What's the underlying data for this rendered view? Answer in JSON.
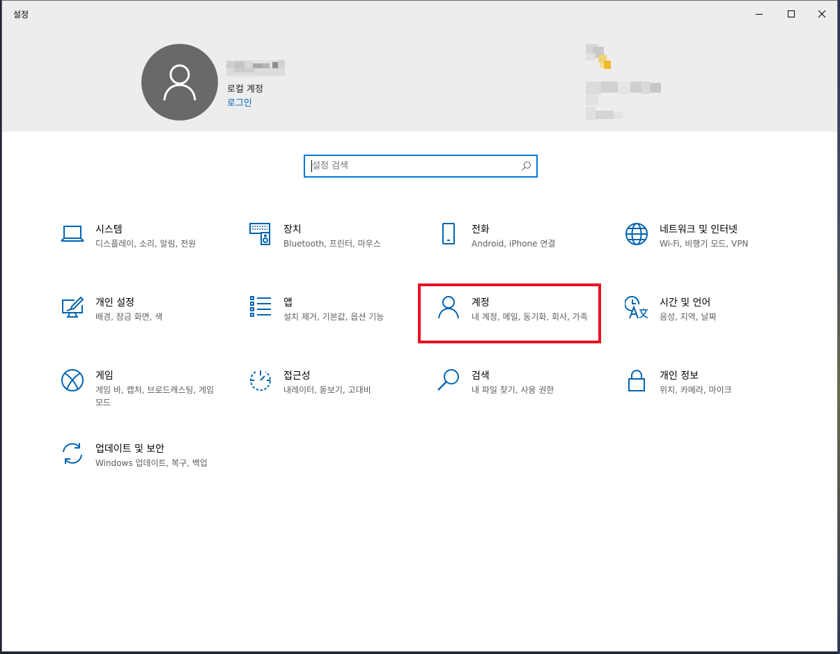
{
  "window": {
    "title": "설정",
    "accent": "#0078d7",
    "controls": {
      "minimize": "minimize-icon",
      "maximize": "maximize-icon",
      "close": "close-icon"
    }
  },
  "profile": {
    "account_type": "로컬 계정",
    "sign_in": "로그인"
  },
  "search": {
    "placeholder": "설정 검색"
  },
  "categories": [
    {
      "icon": "laptop-icon",
      "label": "시스템",
      "desc": "디스플레이, 소리, 알림, 전원"
    },
    {
      "icon": "keyboard-speaker-icon",
      "label": "장치",
      "desc": "Bluetooth, 프린터, 마우스"
    },
    {
      "icon": "phone-icon",
      "label": "전화",
      "desc": "Android, iPhone 연결"
    },
    {
      "icon": "globe-icon",
      "label": "네트워크 및 인터넷",
      "desc": "Wi-Fi, 비행기 모드, VPN"
    },
    {
      "icon": "paint-monitor-icon",
      "label": "개인 설정",
      "desc": "배경, 잠금 화면, 색"
    },
    {
      "icon": "apps-list-icon",
      "label": "앱",
      "desc": "설치 제거, 기본값, 옵션 기능"
    },
    {
      "icon": "person-icon",
      "label": "계정",
      "desc": "내 계정, 메일, 동기화, 회사, 가족"
    },
    {
      "icon": "language-clock-icon",
      "label": "시간 및 언어",
      "desc": "음성, 지역, 날짜"
    },
    {
      "icon": "xbox-icon",
      "label": "게임",
      "desc": "게임 바, 캡처, 브로드캐스팅, 게임 모드"
    },
    {
      "icon": "accessibility-timer-icon",
      "label": "접근성",
      "desc": "내레이터, 돋보기, 고대비"
    },
    {
      "icon": "search-icon",
      "label": "검색",
      "desc": "내 파일 찾기, 사용 권한"
    },
    {
      "icon": "lock-icon",
      "label": "개인 정보",
      "desc": "위치, 카메라, 마이크"
    },
    {
      "icon": "sync-icon",
      "label": "업데이트 및 보안",
      "desc": "Windows 업데이트, 복구, 백업"
    }
  ],
  "highlighted_category": "계정",
  "highlight_color": "#e81123"
}
